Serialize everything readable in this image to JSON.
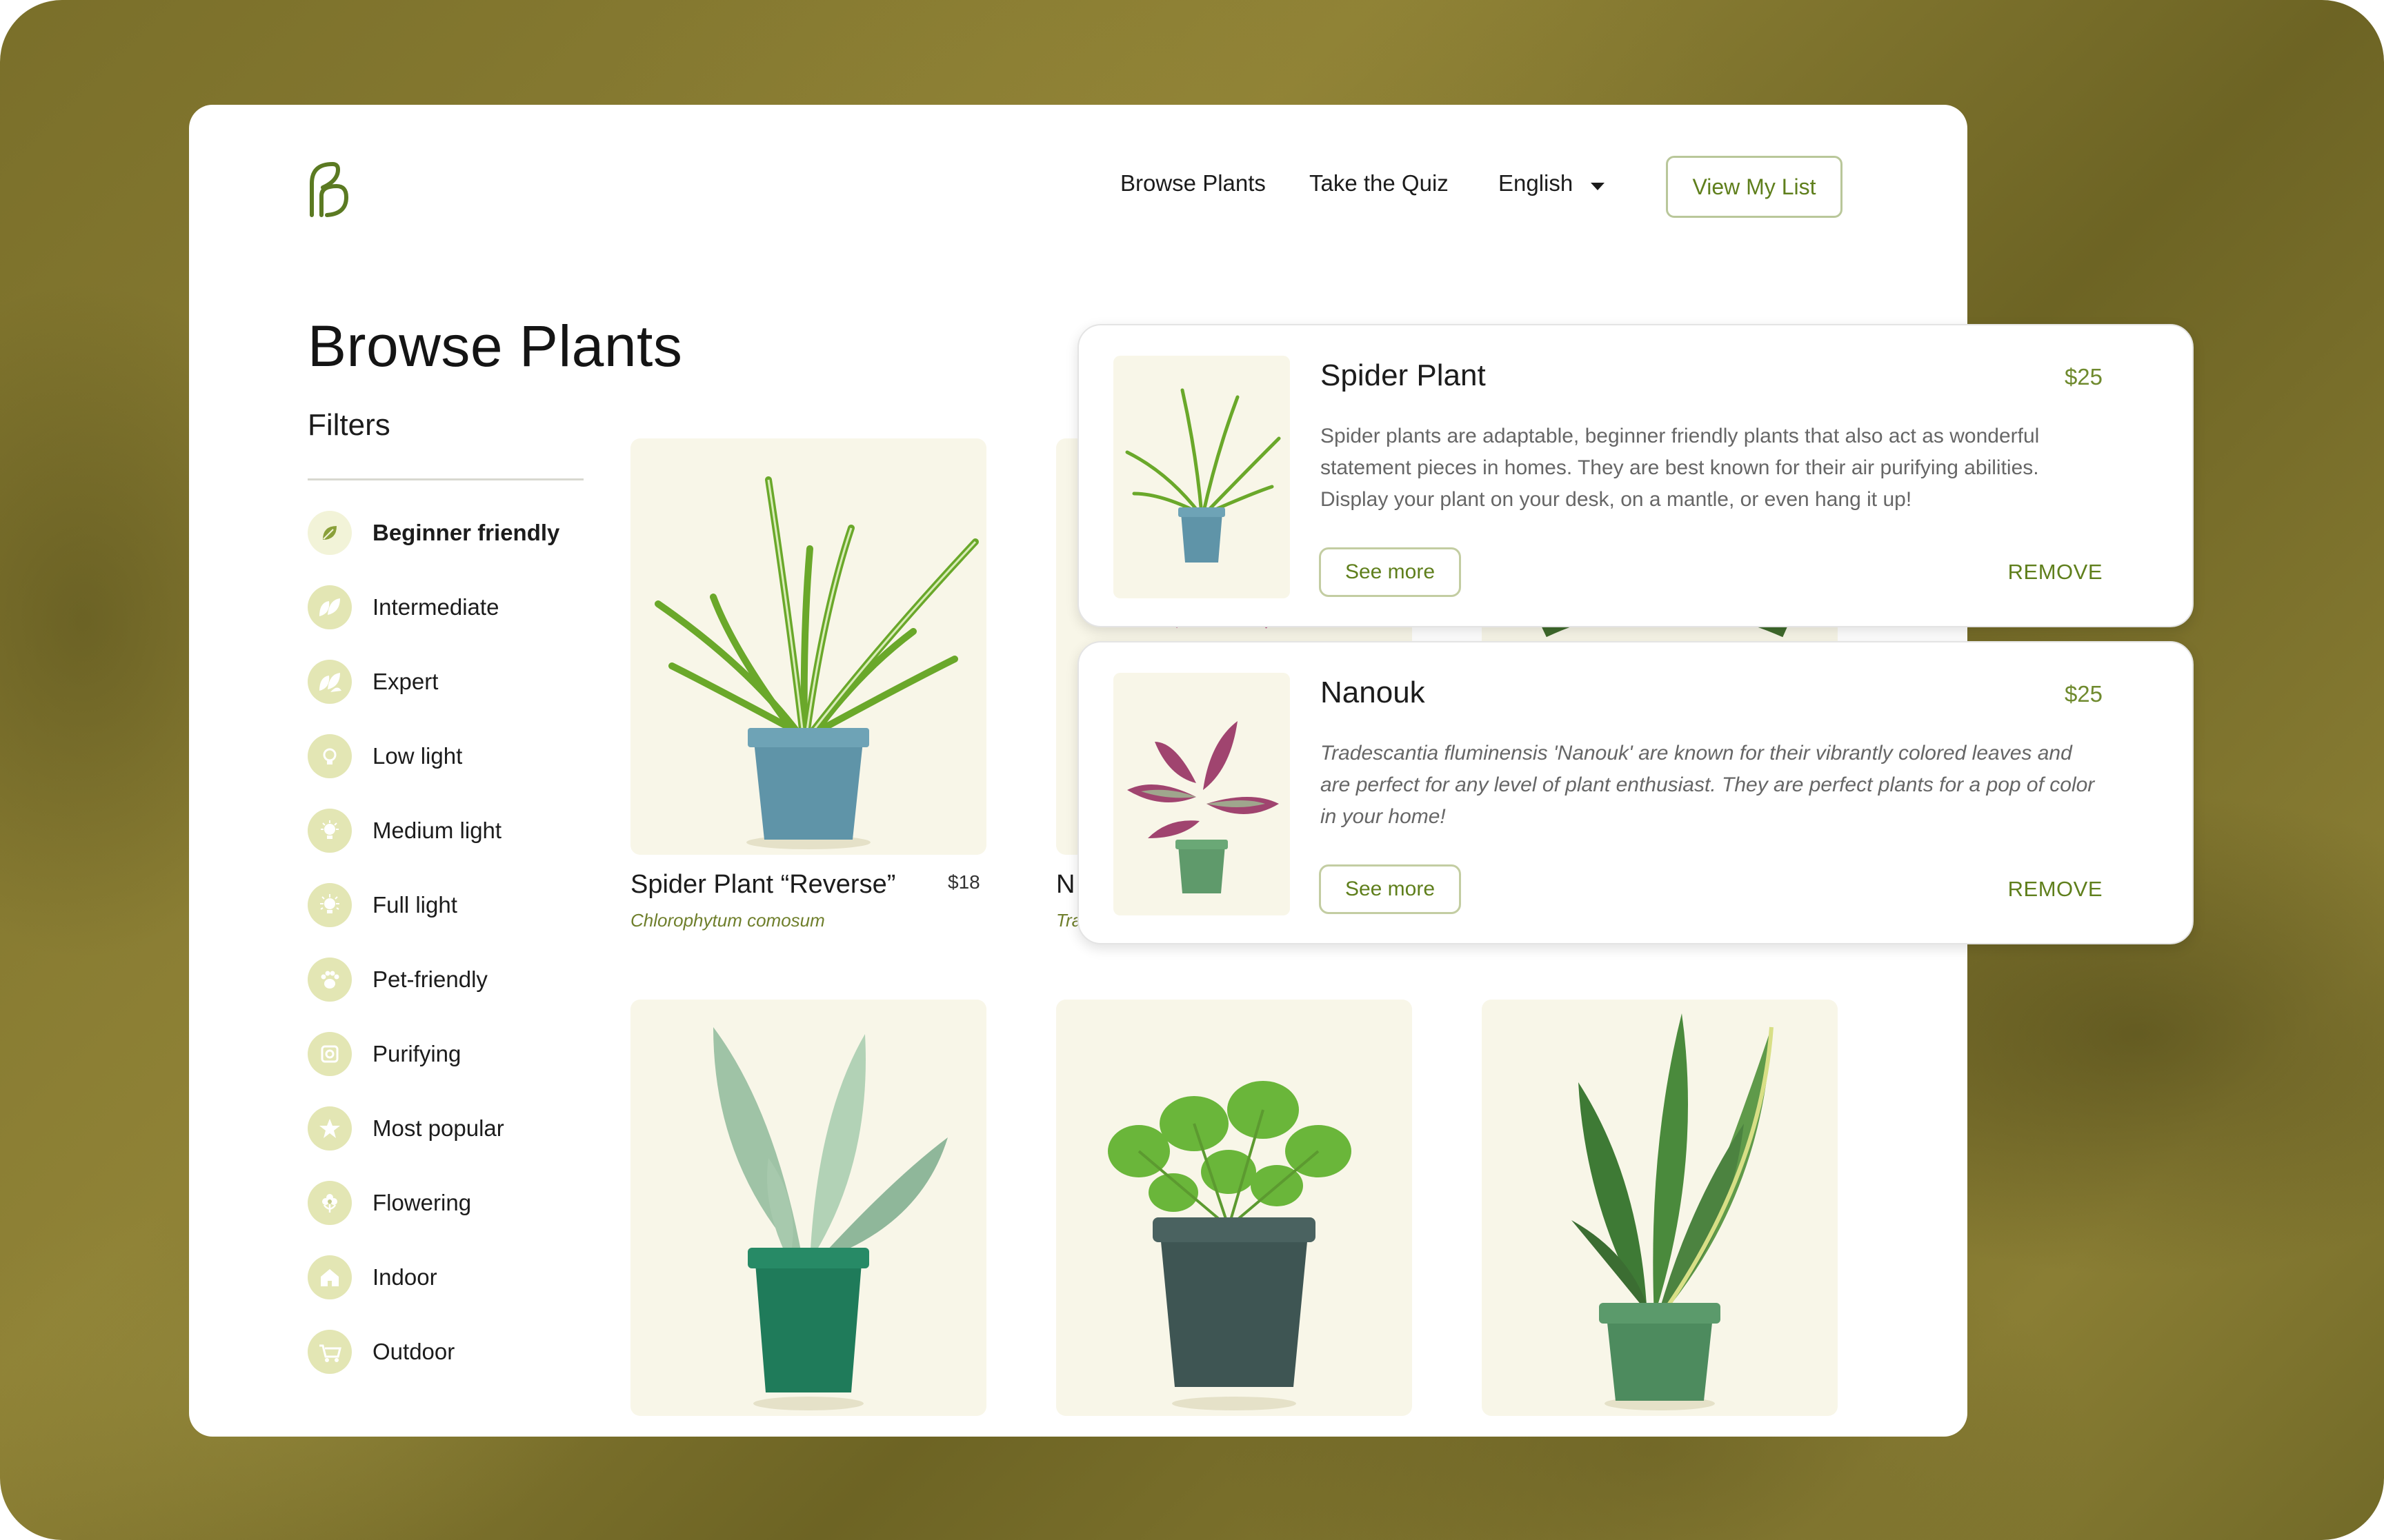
{
  "header": {
    "logo_icon": "leaf-b-logo-icon",
    "nav": {
      "browse": "Browse Plants",
      "quiz": "Take the Quiz",
      "language": "English"
    },
    "view_list": "View My List"
  },
  "page": {
    "title": "Browse Plants",
    "filters_heading": "Filters"
  },
  "filters": [
    {
      "label": "Beginner friendly",
      "icon": "leaf-icon"
    },
    {
      "label": "Intermediate",
      "icon": "leaves-icon"
    },
    {
      "label": "Expert",
      "icon": "leaves-icon"
    },
    {
      "label": "Low light",
      "icon": "bulb-icon"
    },
    {
      "label": "Medium light",
      "icon": "bulb-icon"
    },
    {
      "label": "Full light",
      "icon": "bulb-icon"
    },
    {
      "label": "Pet-friendly",
      "icon": "paw-icon"
    },
    {
      "label": "Purifying",
      "icon": "purify-icon"
    },
    {
      "label": "Most popular",
      "icon": "star-icon"
    },
    {
      "label": "Flowering",
      "icon": "flower-icon"
    },
    {
      "label": "Indoor",
      "icon": "house-icon"
    },
    {
      "label": "Outdoor",
      "icon": "cart-icon"
    }
  ],
  "products": [
    {
      "name": "Spider Plant “Reverse”",
      "scientific": "Chlorophytum comosum",
      "price": "$18"
    },
    {
      "name": "N",
      "scientific": "Tra"
    }
  ],
  "my_list": [
    {
      "name": "Spider Plant",
      "price": "$25",
      "description": "Spider plants are adaptable, beginner friendly plants that also act as wonderful statement pieces in homes. They are best known for their air purifying abilities. Display your plant on your desk, on a mantle, or even hang it up!",
      "see_more": "See more",
      "remove": "REMOVE"
    },
    {
      "name": "Nanouk",
      "price": "$25",
      "description": "Tradescantia fluminensis 'Nanouk' are known for their vibrantly colored leaves and are perfect for any level of plant enthusiast. They are perfect plants for a pop of color in your home!",
      "see_more": "See more",
      "remove": "REMOVE"
    }
  ],
  "colors": {
    "accent": "#5f7f1c",
    "icon_bg": "#e3e6b4",
    "card_bg": "#f8f6e8"
  }
}
